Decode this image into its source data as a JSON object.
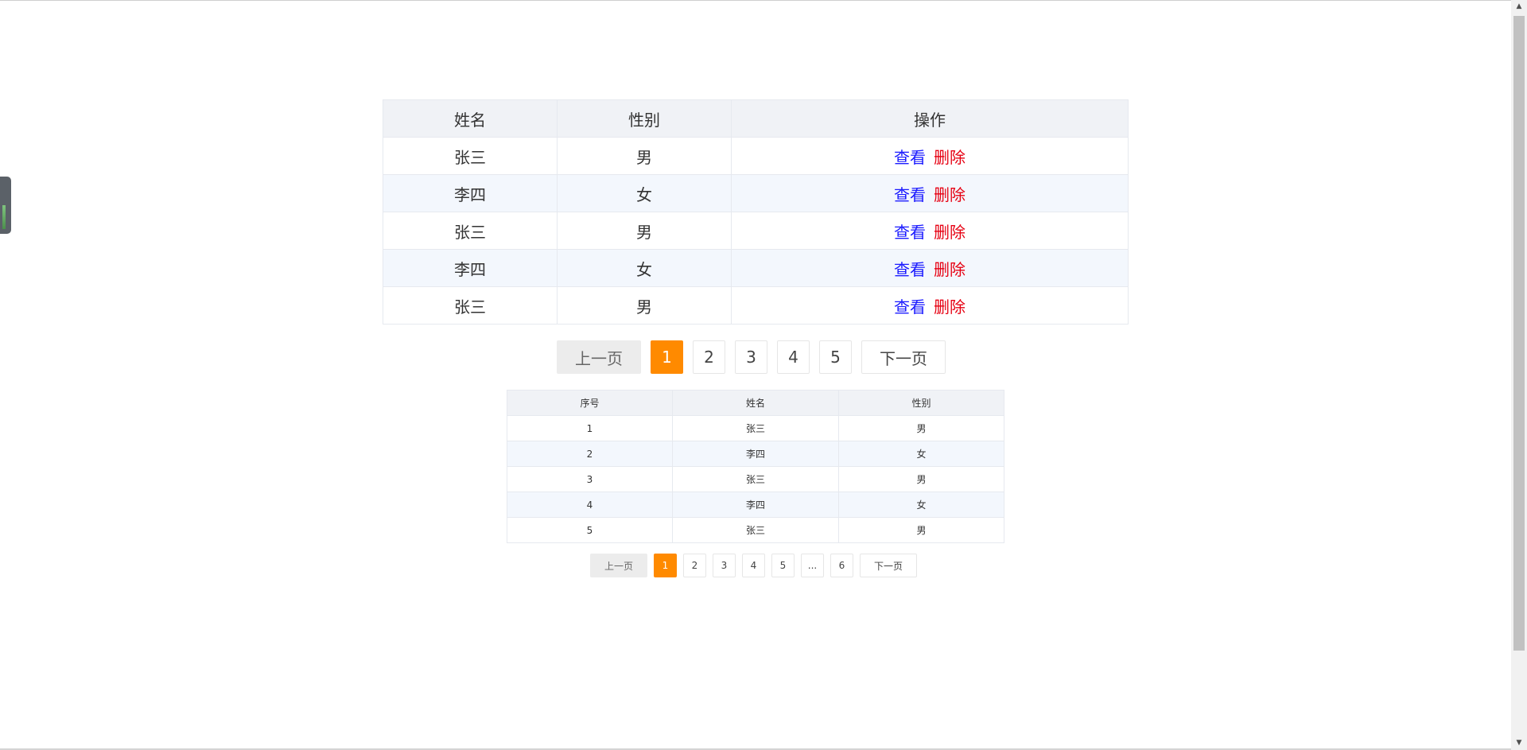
{
  "main_table": {
    "headers": [
      "姓名",
      "性别",
      "操作"
    ],
    "rows": [
      {
        "name": "张三",
        "gender": "男",
        "view": "查看",
        "delete": "删除"
      },
      {
        "name": "李四",
        "gender": "女",
        "view": "查看",
        "delete": "删除"
      },
      {
        "name": "张三",
        "gender": "男",
        "view": "查看",
        "delete": "删除"
      },
      {
        "name": "李四",
        "gender": "女",
        "view": "查看",
        "delete": "删除"
      },
      {
        "name": "张三",
        "gender": "男",
        "view": "查看",
        "delete": "删除"
      }
    ]
  },
  "main_pager": {
    "prev": "上一页",
    "pages": [
      "1",
      "2",
      "3",
      "4",
      "5"
    ],
    "active": "1",
    "next": "下一页"
  },
  "small_table": {
    "headers": [
      "序号",
      "姓名",
      "性别"
    ],
    "rows": [
      {
        "index": "1",
        "name": "张三",
        "gender": "男"
      },
      {
        "index": "2",
        "name": "李四",
        "gender": "女"
      },
      {
        "index": "3",
        "name": "张三",
        "gender": "男"
      },
      {
        "index": "4",
        "name": "李四",
        "gender": "女"
      },
      {
        "index": "5",
        "name": "张三",
        "gender": "男"
      }
    ]
  },
  "small_pager": {
    "prev": "上一页",
    "pages": [
      "1",
      "2",
      "3",
      "4",
      "5",
      "...",
      "6"
    ],
    "active": "1",
    "next": "下一页"
  },
  "colors": {
    "accent": "#ff8a00",
    "view_link": "#1a1aff",
    "delete_link": "#e60012",
    "header_bg": "#f0f2f6",
    "stripe_bg": "#f3f7fd"
  }
}
